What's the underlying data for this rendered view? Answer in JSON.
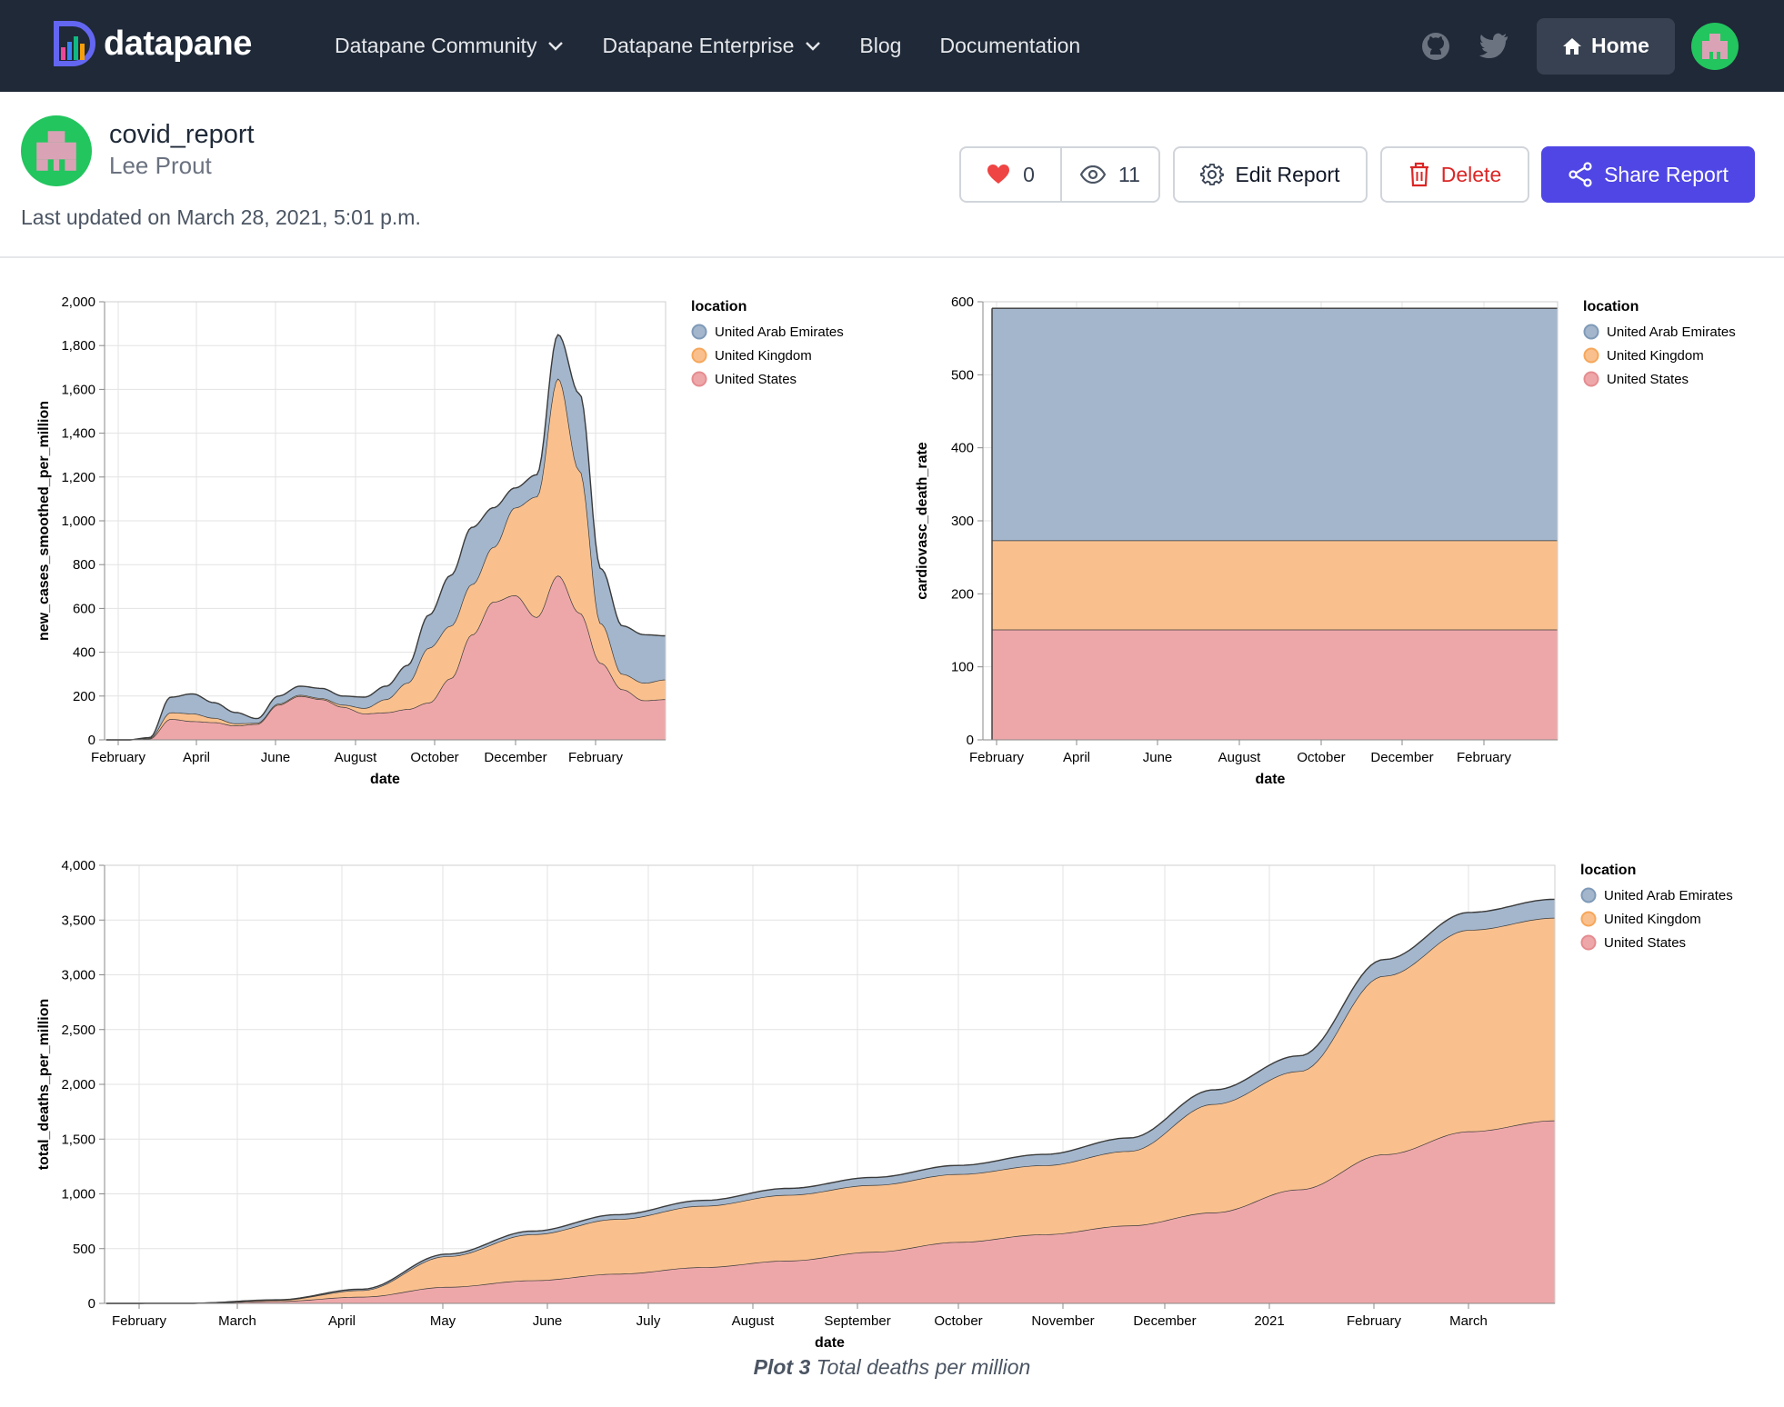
{
  "nav": {
    "brand": "datapane",
    "links": [
      {
        "label": "Datapane Community",
        "dropdown": true
      },
      {
        "label": "Datapane Enterprise",
        "dropdown": true
      },
      {
        "label": "Blog",
        "dropdown": false
      },
      {
        "label": "Documentation",
        "dropdown": false
      }
    ],
    "home_label": "Home"
  },
  "report": {
    "title": "covid_report",
    "author": "Lee Prout",
    "updated": "Last updated on March 28, 2021, 5:01 p.m.",
    "likes": "0",
    "views": "11",
    "edit_label": "Edit Report",
    "delete_label": "Delete",
    "share_label": "Share Report"
  },
  "caption": {
    "prefix": "Plot 3",
    "text": "Total deaths per million"
  },
  "colors": {
    "uae": "#a3b6cc",
    "uk": "#f9c08e",
    "us": "#eea7a9",
    "nav_bg": "#1f2937",
    "share": "#4f46e5",
    "delete": "#dc2626"
  },
  "chart_data": [
    {
      "type": "area",
      "stacked": true,
      "xlabel": "date",
      "ylabel": "new_cases_smoothed_per_million",
      "ylim": [
        0,
        2000
      ],
      "yticks": [
        "0",
        "200",
        "400",
        "600",
        "800",
        "1,000",
        "1,200",
        "1,400",
        "1,600",
        "1,800",
        "2,000"
      ],
      "xticks": [
        "February",
        "April",
        "June",
        "August",
        "October",
        "December",
        "February"
      ],
      "legend_title": "location",
      "legend": [
        "United Arab Emirates",
        "United Kingdom",
        "United States"
      ],
      "x": [
        "2020-02",
        "2020-03",
        "2020-03",
        "2020-04",
        "2020-04",
        "2020-05",
        "2020-05",
        "2020-06",
        "2020-06",
        "2020-07",
        "2020-07",
        "2020-08",
        "2020-08",
        "2020-09",
        "2020-09",
        "2020-10",
        "2020-10",
        "2020-11",
        "2020-11",
        "2020-12",
        "2020-12",
        "2021-01",
        "2021-01",
        "2021-02",
        "2021-02",
        "2021-03",
        "2021-03"
      ],
      "series": [
        {
          "name": "United States",
          "values": [
            0,
            0,
            5,
            95,
            85,
            80,
            65,
            72,
            160,
            200,
            185,
            150,
            120,
            125,
            140,
            170,
            280,
            480,
            630,
            660,
            560,
            750,
            580,
            350,
            230,
            180,
            185
          ]
        },
        {
          "name": "United Kingdom",
          "values": [
            0,
            0,
            3,
            30,
            35,
            20,
            10,
            5,
            5,
            5,
            5,
            10,
            25,
            60,
            120,
            250,
            240,
            230,
            250,
            400,
            550,
            900,
            650,
            180,
            70,
            80,
            90
          ]
        },
        {
          "name": "United Arab Emirates",
          "values": [
            0,
            0,
            2,
            70,
            90,
            70,
            50,
            20,
            35,
            40,
            45,
            40,
            50,
            60,
            80,
            150,
            230,
            260,
            180,
            90,
            100,
            200,
            350,
            250,
            220,
            220,
            200
          ]
        }
      ]
    },
    {
      "type": "area",
      "stacked": true,
      "xlabel": "date",
      "ylabel": "cardiovasc_death_rate",
      "ylim": [
        0,
        600
      ],
      "yticks": [
        "0",
        "100",
        "200",
        "300",
        "400",
        "500",
        "600"
      ],
      "xticks": [
        "February",
        "April",
        "June",
        "August",
        "October",
        "December",
        "February"
      ],
      "legend_title": "location",
      "legend": [
        "United Arab Emirates",
        "United Kingdom",
        "United States"
      ],
      "series": [
        {
          "name": "United States",
          "values": [
            151.1
          ]
        },
        {
          "name": "United Kingdom",
          "values": [
            122.1
          ]
        },
        {
          "name": "United Arab Emirates",
          "values": [
            317.8
          ]
        }
      ]
    },
    {
      "type": "area",
      "stacked": true,
      "xlabel": "date",
      "ylabel": "total_deaths_per_million",
      "ylim": [
        0,
        4000
      ],
      "yticks": [
        "0",
        "500",
        "1,000",
        "1,500",
        "2,000",
        "2,500",
        "3,000",
        "3,500",
        "4,000"
      ],
      "xticks": [
        "February",
        "March",
        "April",
        "May",
        "June",
        "July",
        "August",
        "September",
        "October",
        "November",
        "December",
        "2021",
        "February",
        "March"
      ],
      "legend_title": "location",
      "legend": [
        "United Arab Emirates",
        "United Kingdom",
        "United States"
      ],
      "x": [
        "2020-01-22",
        "2020-03-01",
        "2020-03-20",
        "2020-04-01",
        "2020-04-15",
        "2020-05-01",
        "2020-05-15",
        "2020-06-01",
        "2020-07-01",
        "2020-08-01",
        "2020-09-01",
        "2020-10-01",
        "2020-11-01",
        "2020-12-01",
        "2021-01-01",
        "2021-02-01",
        "2021-03-01",
        "2021-03-27"
      ],
      "series": [
        {
          "name": "United States",
          "values": [
            0,
            1,
            20,
            60,
            150,
            210,
            270,
            330,
            390,
            470,
            560,
            630,
            710,
            830,
            1040,
            1360,
            1570,
            1670
          ]
        },
        {
          "name": "United Kingdom",
          "values": [
            0,
            0,
            10,
            60,
            280,
            420,
            500,
            560,
            600,
            610,
            620,
            630,
            680,
            990,
            1080,
            1630,
            1840,
            1850
          ]
        },
        {
          "name": "United Arab Emirates",
          "values": [
            0,
            0,
            2,
            10,
            20,
            30,
            40,
            50,
            60,
            70,
            80,
            100,
            120,
            130,
            140,
            150,
            160,
            170
          ]
        }
      ]
    }
  ]
}
